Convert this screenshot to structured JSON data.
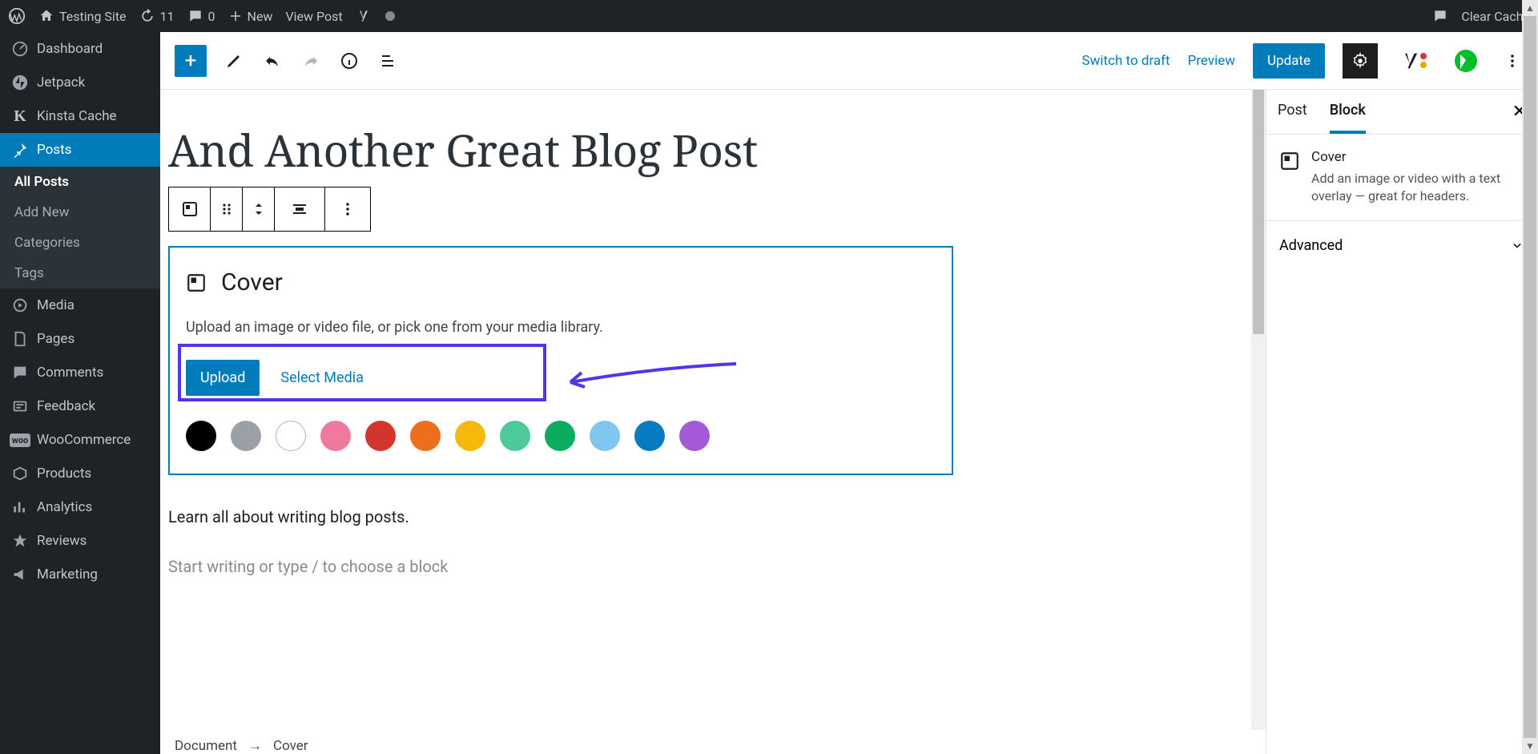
{
  "adminbar": {
    "site_name": "Testing Site",
    "updates": "11",
    "comments": "0",
    "new": "New",
    "view_post": "View Post",
    "clear_cache": "Clear Cache"
  },
  "menu": {
    "dashboard": "Dashboard",
    "jetpack": "Jetpack",
    "kinsta": "Kinsta Cache",
    "posts": "Posts",
    "submenu": {
      "all": "All Posts",
      "add": "Add New",
      "cats": "Categories",
      "tags": "Tags"
    },
    "media": "Media",
    "pages": "Pages",
    "comments": "Comments",
    "feedback": "Feedback",
    "woo": "WooCommerce",
    "products": "Products",
    "analytics": "Analytics",
    "reviews": "Reviews",
    "marketing": "Marketing"
  },
  "toolbar": {
    "switch_draft": "Switch to draft",
    "preview": "Preview",
    "update": "Update"
  },
  "post": {
    "title": "And Another Great Blog Post",
    "paragraph": "Learn all about writing blog posts.",
    "placeholder": "Start writing or type / to choose a block"
  },
  "cover": {
    "title": "Cover",
    "desc": "Upload an image or video file, or pick one from your media library.",
    "upload": "Upload",
    "select": "Select Media",
    "colors": [
      "#000000",
      "#9aa0a6",
      "#ffffff",
      "#f0799e",
      "#d1352b",
      "#ed6f1e",
      "#f4b90b",
      "#4dc99a",
      "#0aac5e",
      "#7fc7f1",
      "#067bc2",
      "#a45ad6"
    ]
  },
  "crumbs": {
    "document": "Document",
    "arrow": "→",
    "cover": "Cover"
  },
  "sidebar": {
    "tab_post": "Post",
    "tab_block": "Block",
    "block_name": "Cover",
    "block_desc": "Add an image or video with a text overlay — great for headers.",
    "advanced": "Advanced"
  }
}
